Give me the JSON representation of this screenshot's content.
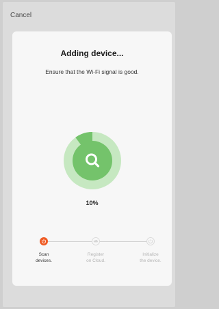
{
  "header": {
    "cancel_label": "Cancel"
  },
  "card": {
    "title": "Adding device...",
    "subtitle": "Ensure that the Wi-Fi signal is good.",
    "progress": {
      "value": 0.1,
      "label": "10%"
    },
    "center_icon": "search-icon"
  },
  "steps": [
    {
      "line1": "Scan",
      "line2": "devices.",
      "state": "active",
      "icon": "power-icon"
    },
    {
      "line1": "Register",
      "line2": "on Cloud.",
      "state": "pending",
      "icon": "cloud-icon"
    },
    {
      "line1": "Initialize",
      "line2": "the device.",
      "state": "pending",
      "icon": "circle-icon"
    }
  ],
  "colors": {
    "accent_green": "#74c36b",
    "ring_light": "#c6e8c1",
    "step_active": "#ef5b24",
    "step_inactive": "#d6d6d6"
  }
}
